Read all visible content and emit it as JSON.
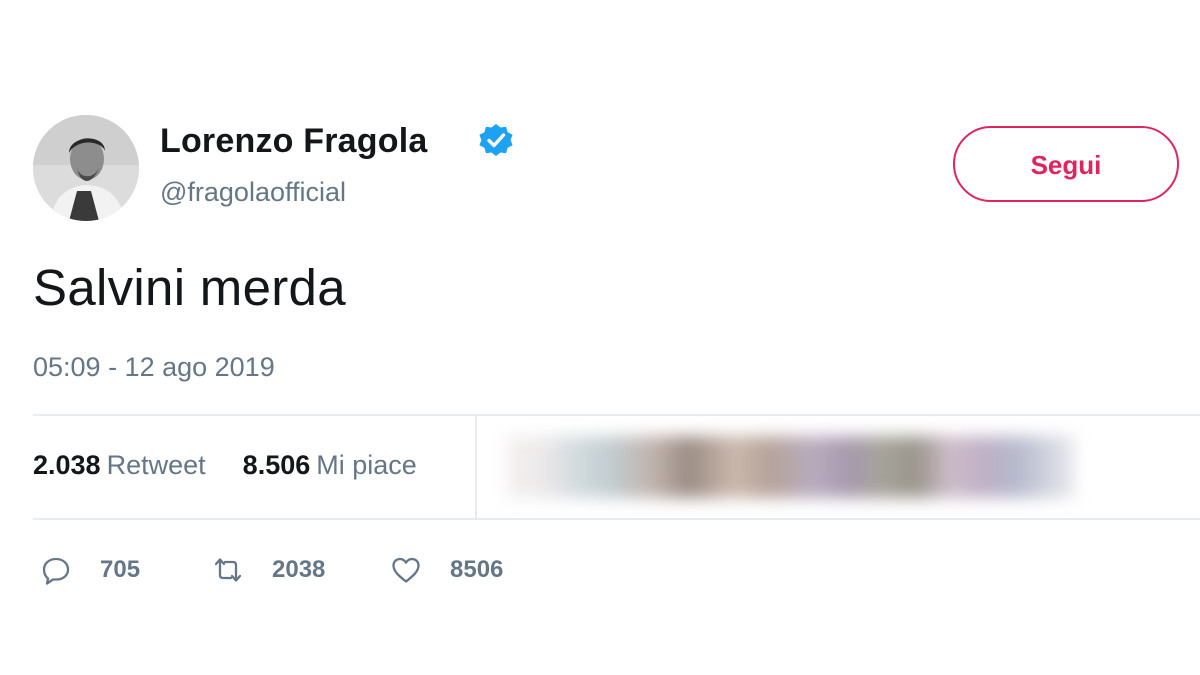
{
  "user": {
    "display_name": "Lorenzo Fragola",
    "handle": "@fragolaofficial",
    "verified": true
  },
  "follow_button": {
    "label": "Segui"
  },
  "tweet": {
    "text": "Salvini merda",
    "timestamp": "05:09 - 12 ago 2019"
  },
  "stats": {
    "retweets_count": "2.038",
    "retweets_label": "Retweet",
    "likes_count": "8.506",
    "likes_label": "Mi piace"
  },
  "actions": {
    "reply_count": "705",
    "retweet_count": "2038",
    "like_count": "8506"
  },
  "colors": {
    "accent": "#e0245e",
    "verified": "#1da1f2",
    "secondary_text": "#657786",
    "divider": "#e6ecf0"
  },
  "icons": {
    "verified": "verified-badge-icon",
    "reply": "reply-icon",
    "retweet": "retweet-icon",
    "like": "heart-icon"
  }
}
